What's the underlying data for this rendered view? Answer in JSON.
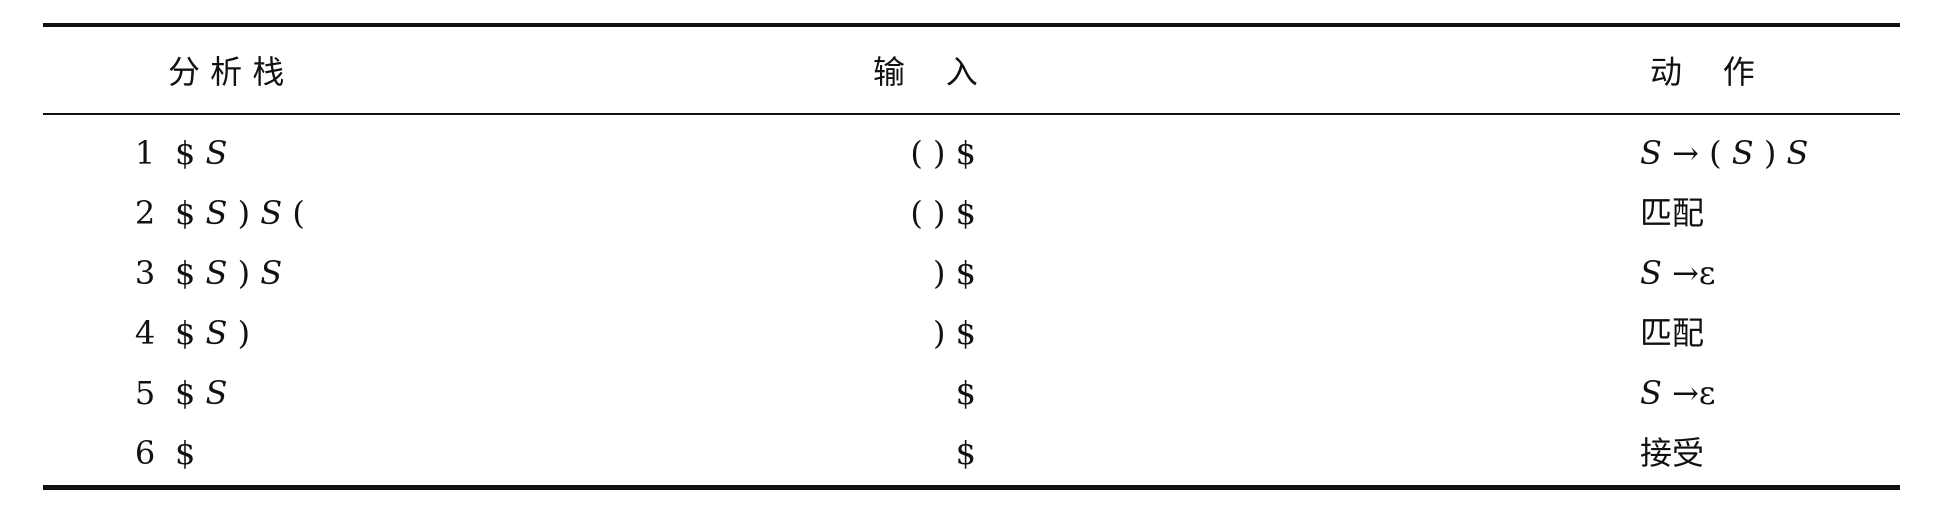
{
  "headers": {
    "stack": "分 析 栈",
    "input": "输    入",
    "action": "动    作"
  },
  "rows": [
    {
      "num": "1",
      "stack": "$ S",
      "input": "( ) $",
      "action": "S → ( S ) S"
    },
    {
      "num": "2",
      "stack": "$ S ) S (",
      "input": "( ) $",
      "action": "匹配"
    },
    {
      "num": "3",
      "stack": "$ S ) S",
      "input": ") $",
      "action": "S →ε"
    },
    {
      "num": "4",
      "stack": "$ S )",
      "input": ") $",
      "action": "匹配"
    },
    {
      "num": "5",
      "stack": "$ S",
      "input": "$",
      "action": "S →ε"
    },
    {
      "num": "6",
      "stack": "$",
      "input": "$",
      "action": "接受"
    }
  ]
}
